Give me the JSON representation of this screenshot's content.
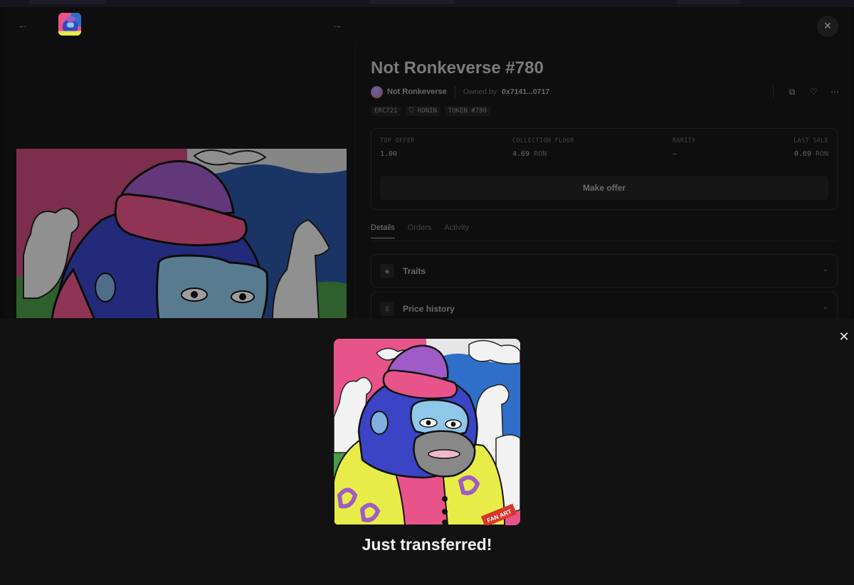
{
  "nft": {
    "title": "Not Ronkeverse #780",
    "collection": "Not Ronkeverse",
    "owned_by_label": "Owned by",
    "owner": "0x7141...0717",
    "chips": [
      "ERC721",
      "RONIN",
      "TOKEN #780"
    ],
    "stats": {
      "top_offer": {
        "label": "TOP OFFER",
        "value": "1.00"
      },
      "collection_floor": {
        "label": "COLLECTION FLOOR",
        "value": "4.69",
        "unit": "RON"
      },
      "rarity": {
        "label": "RARITY",
        "value": "–"
      },
      "last_sale": {
        "label": "LAST SALE",
        "value": "0.69",
        "unit": "RON"
      }
    },
    "make_offer_label": "Make offer",
    "tabs": [
      {
        "label": "Details",
        "active": true
      },
      {
        "label": "Orders",
        "active": false
      },
      {
        "label": "Activity",
        "active": false
      }
    ],
    "accordions": [
      {
        "label": "Traits",
        "icon": "diamond-icon"
      },
      {
        "label": "Price history",
        "icon": "dollar-icon"
      }
    ]
  },
  "toast": {
    "message": "Just transferred!",
    "badge": "FAN ART"
  },
  "colors": {
    "toast_bg": "#121212",
    "modal_bg": "#0e0e0e",
    "art_pink": "#e8548a",
    "art_blue": "#3a44c4",
    "art_purple": "#9f5bc6",
    "art_yellow": "#e8ec48"
  }
}
